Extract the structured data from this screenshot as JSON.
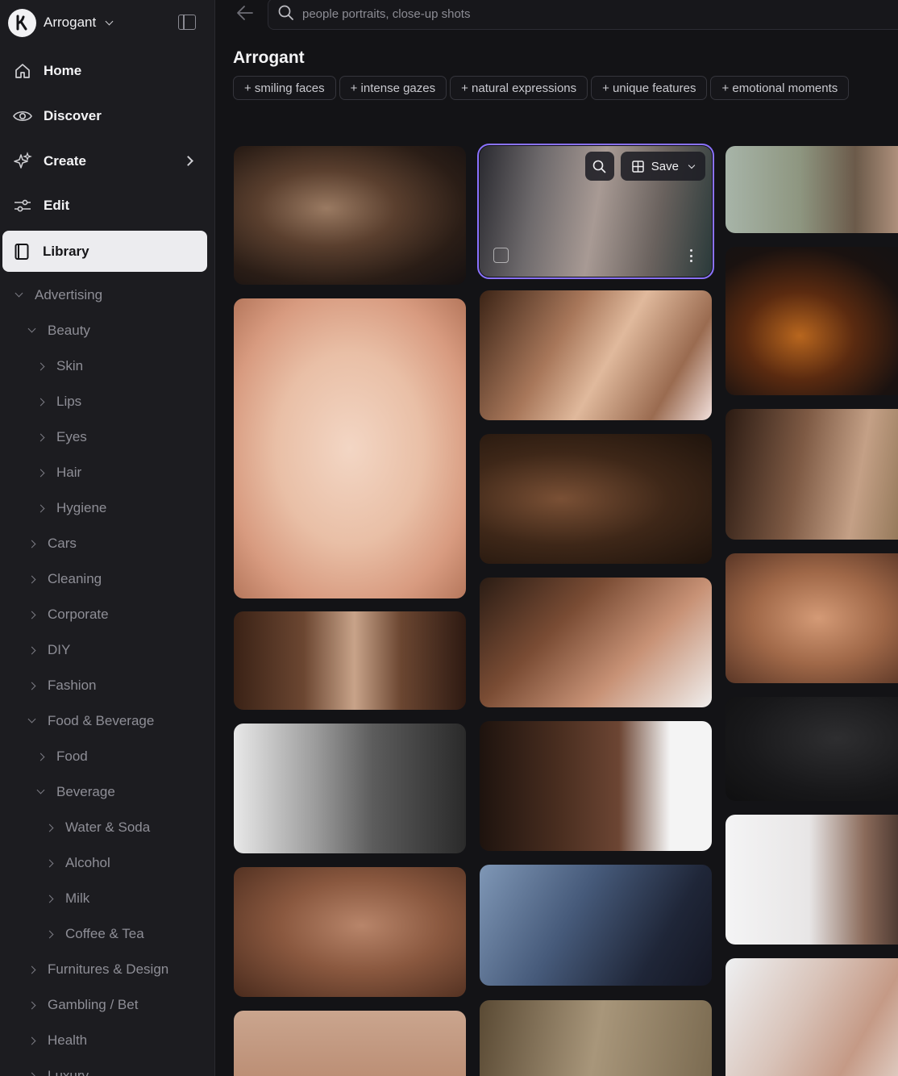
{
  "workspace": {
    "name": "Arrogant"
  },
  "nav": [
    {
      "label": "Home",
      "icon": "home-icon"
    },
    {
      "label": "Discover",
      "icon": "eye-icon"
    },
    {
      "label": "Create",
      "icon": "sparkle-icon"
    },
    {
      "label": "Edit",
      "icon": "sliders-icon"
    },
    {
      "label": "Library",
      "icon": "book-icon",
      "active": true
    }
  ],
  "tree": [
    {
      "label": "Advertising",
      "level": 0,
      "expanded": true
    },
    {
      "label": "Beauty",
      "level": 1,
      "expanded": true
    },
    {
      "label": "Skin",
      "level": 2,
      "expanded": false
    },
    {
      "label": "Lips",
      "level": 2,
      "expanded": false
    },
    {
      "label": "Eyes",
      "level": 2,
      "expanded": false
    },
    {
      "label": "Hair",
      "level": 2,
      "expanded": false
    },
    {
      "label": "Hygiene",
      "level": 2,
      "expanded": false
    },
    {
      "label": "Cars",
      "level": 1,
      "expanded": false
    },
    {
      "label": "Cleaning",
      "level": 1,
      "expanded": false
    },
    {
      "label": "Corporate",
      "level": 1,
      "expanded": false
    },
    {
      "label": "DIY",
      "level": 1,
      "expanded": false
    },
    {
      "label": "Fashion",
      "level": 1,
      "expanded": false
    },
    {
      "label": "Food & Beverage",
      "level": 1,
      "expanded": true
    },
    {
      "label": "Food",
      "level": 2,
      "expanded": false
    },
    {
      "label": "Beverage",
      "level": 2,
      "expanded": true
    },
    {
      "label": "Water & Soda",
      "level": 3,
      "expanded": false
    },
    {
      "label": "Alcohol",
      "level": 3,
      "expanded": false
    },
    {
      "label": "Milk",
      "level": 3,
      "expanded": false
    },
    {
      "label": "Coffee & Tea",
      "level": 3,
      "expanded": false
    },
    {
      "label": "Furnitures & Design",
      "level": 1,
      "expanded": false
    },
    {
      "label": "Gambling / Bet",
      "level": 1,
      "expanded": false
    },
    {
      "label": "Health",
      "level": 1,
      "expanded": false
    },
    {
      "label": "Luxury",
      "level": 1,
      "expanded": false
    }
  ],
  "search": {
    "placeholder": "people portraits, close-up shots"
  },
  "page": {
    "title": "Arrogant"
  },
  "chips": [
    "+ smiling faces",
    "+ intense gazes",
    "+ natural expressions",
    "+ unique features",
    "+ emotional moments"
  ],
  "tile_actions": {
    "save_label": "Save"
  },
  "colors": {
    "accent": "#8a72ff",
    "active_nav_bg": "#ececef",
    "background": "#131316",
    "sidebar": "#1c1c20"
  }
}
